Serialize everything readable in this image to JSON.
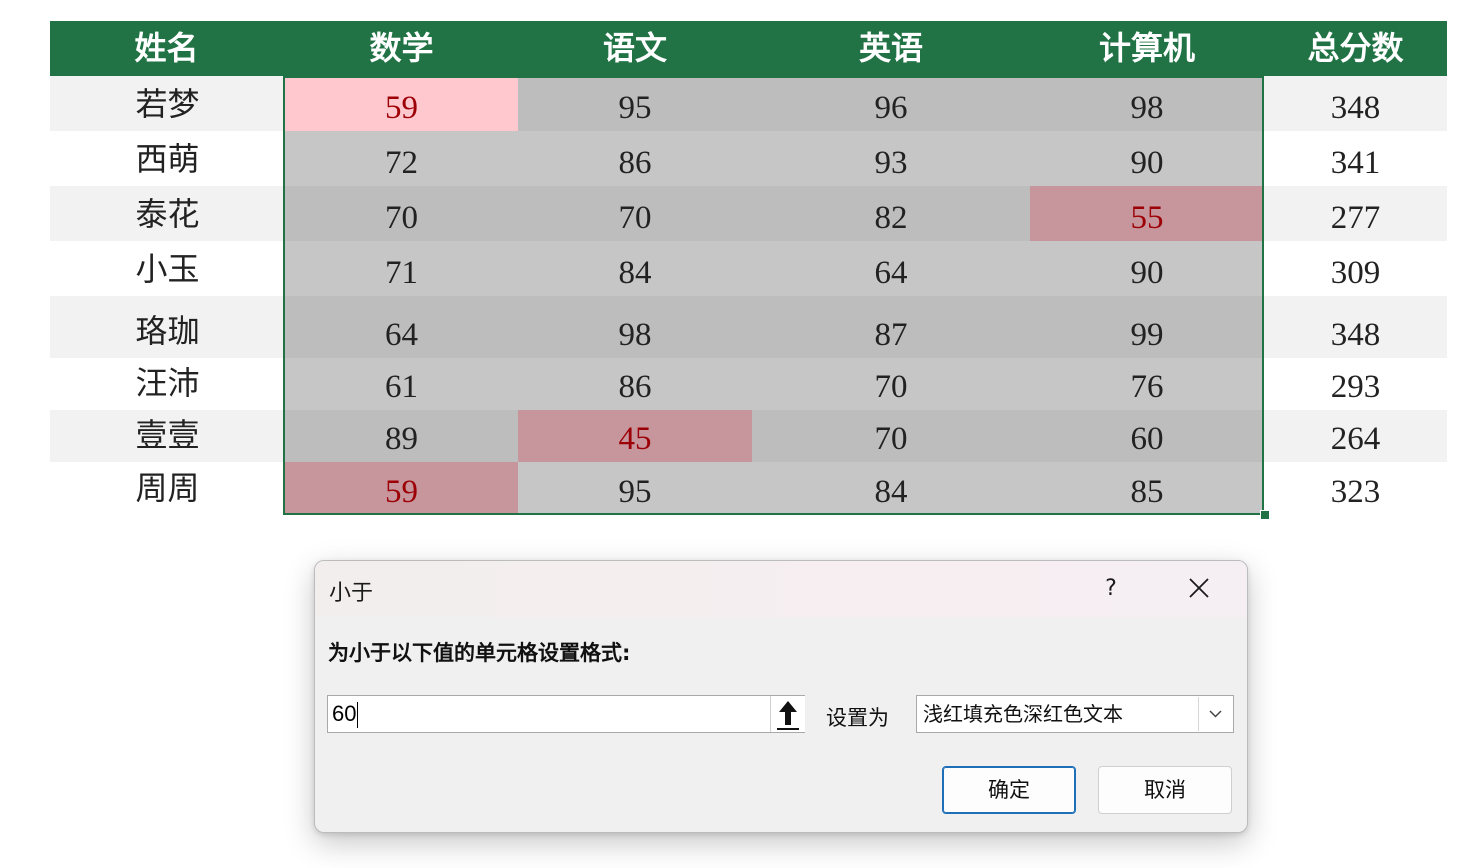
{
  "sheet": {
    "headers": [
      "姓名",
      "数学",
      "语文",
      "英语",
      "计算机",
      "总分数"
    ],
    "rows": [
      {
        "name": "若梦",
        "math": "59",
        "chinese": "95",
        "english": "96",
        "computer": "98",
        "total": "348"
      },
      {
        "name": "西萌",
        "math": "72",
        "chinese": "86",
        "english": "93",
        "computer": "90",
        "total": "341"
      },
      {
        "name": "泰花",
        "math": "70",
        "chinese": "70",
        "english": "82",
        "computer": "55",
        "total": "277"
      },
      {
        "name": "小玉",
        "math": "71",
        "chinese": "84",
        "english": "64",
        "computer": "90",
        "total": "309"
      },
      {
        "name": "珞珈",
        "math": "64",
        "chinese": "98",
        "english": "87",
        "computer": "99",
        "total": "348"
      },
      {
        "name": "汪沛",
        "math": "61",
        "chinese": "86",
        "english": "70",
        "computer": "76",
        "total": "293"
      },
      {
        "name": "壹壹",
        "math": "89",
        "chinese": "45",
        "english": "70",
        "computer": "60",
        "total": "264"
      },
      {
        "name": "周周",
        "math": "59",
        "chinese": "95",
        "english": "84",
        "computer": "85",
        "total": "323"
      }
    ],
    "colors": {
      "header_bg": "#217346",
      "highlight_fill": "#ffc7ce",
      "highlight_text": "#9c0006"
    }
  },
  "dialog": {
    "title": "小于",
    "help_label": "?",
    "prompt": "为小于以下值的单元格设置格式:",
    "value": "60",
    "set_as_label": "设置为",
    "format_option": "浅红填充色深红色文本",
    "ok_label": "确定",
    "cancel_label": "取消",
    "icons": {
      "close": "close-icon",
      "collapse": "range-select-arrow-icon",
      "dropdown": "chevron-down-icon"
    }
  }
}
